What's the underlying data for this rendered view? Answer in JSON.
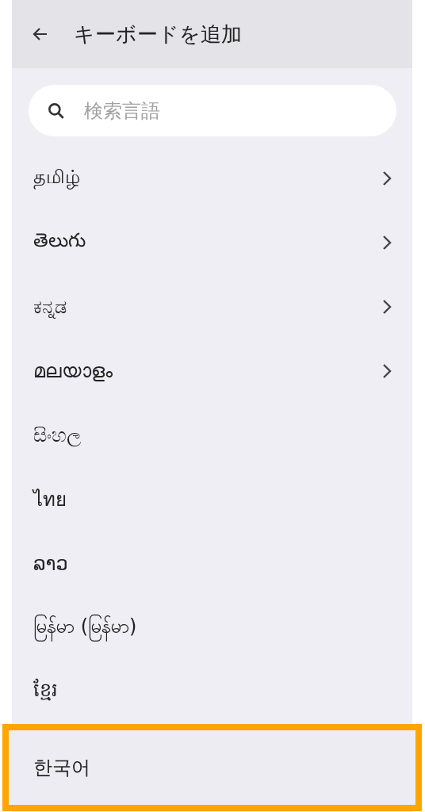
{
  "header": {
    "title": "キーボードを追加"
  },
  "search": {
    "placeholder": "検索言語"
  },
  "languages": [
    {
      "label": "தமிழ்",
      "expandable": true,
      "highlighted": false
    },
    {
      "label": "తెలుగు",
      "expandable": true,
      "highlighted": false
    },
    {
      "label": "ಕನ್ನಡ",
      "expandable": true,
      "highlighted": false
    },
    {
      "label": "മലയാളം",
      "expandable": true,
      "highlighted": false
    },
    {
      "label": "සිංහල",
      "expandable": false,
      "highlighted": false
    },
    {
      "label": "ไทย",
      "expandable": false,
      "highlighted": false
    },
    {
      "label": "ລາວ",
      "expandable": false,
      "highlighted": false
    },
    {
      "label": "မြန်မာ (မြန်မာ)",
      "expandable": false,
      "highlighted": false
    },
    {
      "label": "ខ្មែរ",
      "expandable": false,
      "highlighted": false
    },
    {
      "label": "한국어",
      "expandable": false,
      "highlighted": true
    }
  ]
}
